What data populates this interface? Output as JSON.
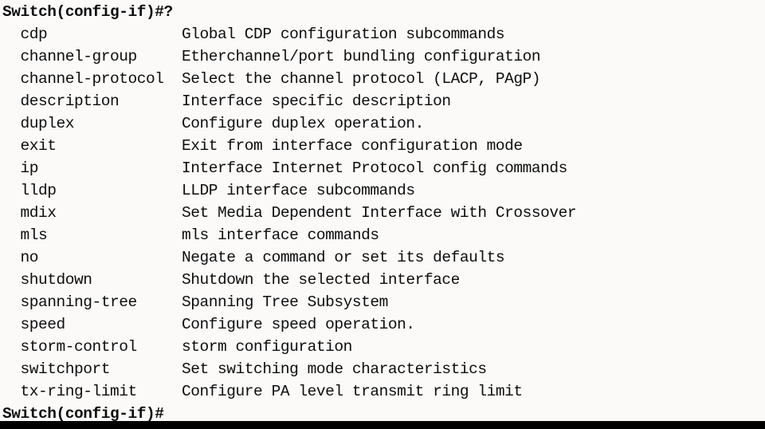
{
  "terminal": {
    "device_prompt": "Switch(config-if)#",
    "colors": {
      "background": "#fbfaf9",
      "text": "#0d0d0d",
      "bottom_bar": "#000000"
    },
    "header_line": "Switch(config-if)#?",
    "query_char": "?",
    "footer_line": "Switch(config-if)#",
    "indent": "  ",
    "command_column_width": 18,
    "commands": [
      {
        "name": "cdp",
        "description": "Global CDP configuration subcommands"
      },
      {
        "name": "channel-group",
        "description": "Etherchannel/port bundling configuration"
      },
      {
        "name": "channel-protocol",
        "description": "Select the channel protocol (LACP, PAgP)"
      },
      {
        "name": "description",
        "description": "Interface specific description"
      },
      {
        "name": "duplex",
        "description": "Configure duplex operation."
      },
      {
        "name": "exit",
        "description": "Exit from interface configuration mode"
      },
      {
        "name": "ip",
        "description": "Interface Internet Protocol config commands"
      },
      {
        "name": "lldp",
        "description": "LLDP interface subcommands"
      },
      {
        "name": "mdix",
        "description": "Set Media Dependent Interface with Crossover"
      },
      {
        "name": "mls",
        "description": "mls interface commands"
      },
      {
        "name": "no",
        "description": "Negate a command or set its defaults"
      },
      {
        "name": "shutdown",
        "description": "Shutdown the selected interface"
      },
      {
        "name": "spanning-tree",
        "description": "Spanning Tree Subsystem"
      },
      {
        "name": "speed",
        "description": "Configure speed operation."
      },
      {
        "name": "storm-control",
        "description": "storm configuration"
      },
      {
        "name": "switchport",
        "description": "Set switching mode characteristics"
      },
      {
        "name": "tx-ring-limit",
        "description": "Configure PA level transmit ring limit"
      }
    ]
  }
}
